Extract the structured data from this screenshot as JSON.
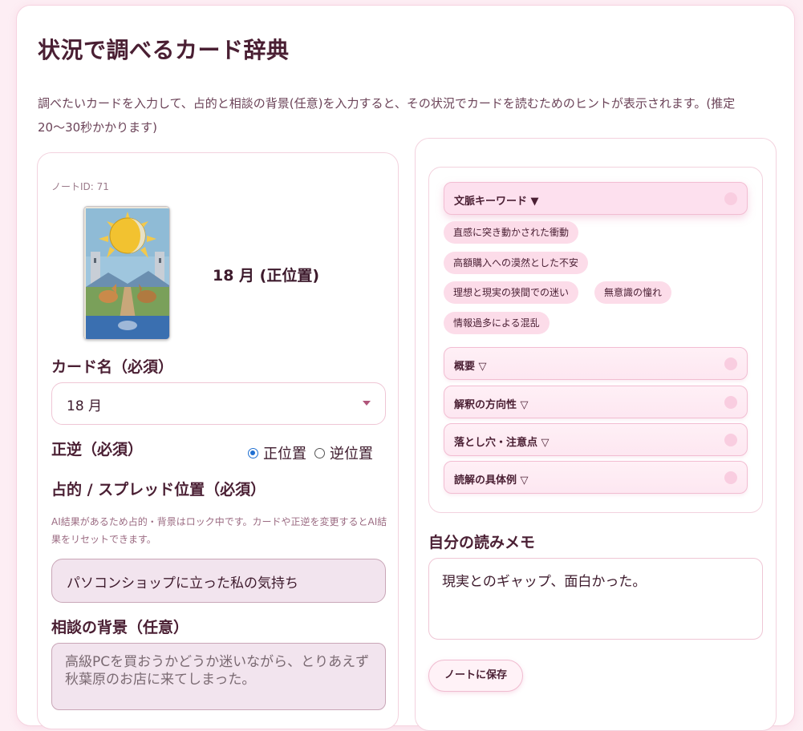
{
  "page": {
    "title": "状況で調べるカード辞典",
    "description": "調べたいカードを入力して、占的と相談の背景(任意)を入力すると、その状況でカードを読むためのヒントが表示されます。(推定20〜30秒かかります)"
  },
  "left": {
    "note_id": "ノートID: 71",
    "card_caption": "18 月 (正位置)",
    "card_name_label": "カード名（必須）",
    "card_name_value": "18 月",
    "orientation_label": "正逆（必須）",
    "orientation_options": [
      "正位置",
      "逆位置"
    ],
    "orientation_selected": "正位置",
    "question_label": "占的 / スプレッド位置（必須）",
    "lock_note": "AI結果があるため占的・背景はロック中です。カードや正逆を変更するとAI結果をリセットできます。",
    "question_value": "パソコンショップに立った私の気持ち",
    "background_label": "相談の背景（任意）",
    "background_value": "高級PCを買おうかどうか迷いながら、とりあえず秋葉原のお店に来てしまった。"
  },
  "right": {
    "sections": [
      {
        "label": "文脈キーワード ▼",
        "open": true
      },
      {
        "label": "概要 ▽",
        "open": false
      },
      {
        "label": "解釈の方向性 ▽",
        "open": false
      },
      {
        "label": "落とし穴・注意点 ▽",
        "open": false
      },
      {
        "label": "読解の具体例 ▽",
        "open": false
      }
    ],
    "keywords": [
      "直感に突き動かされた衝動",
      "高額購入への漠然とした不安",
      "理想と現実の狭間での迷い",
      "無意識の憧れ",
      "情報過多による混乱"
    ],
    "memo_label": "自分の読みメモ",
    "memo_value": "現実とのギャップ、面白かった。",
    "save_label": "ノートに保存"
  },
  "colors": {
    "accent": "#f9cde0",
    "chip_bg": "#fcdce9",
    "text": "#4a1f33",
    "radio_active": "#1f6fd1"
  }
}
